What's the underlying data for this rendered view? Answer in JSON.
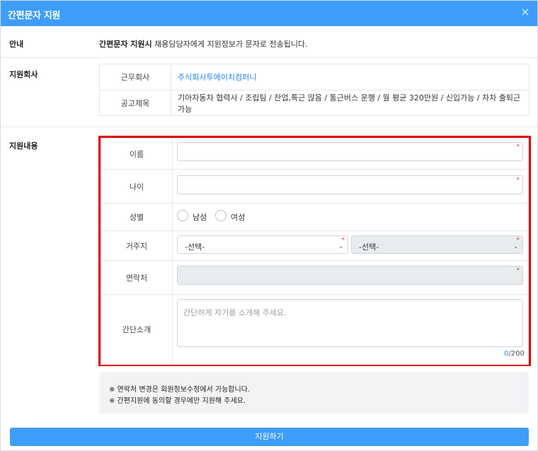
{
  "dialog": {
    "title": "간편문자 지원",
    "close_icon": "×"
  },
  "guide": {
    "label": "안내",
    "bold": "간편문자 지원시",
    "text": " 채용담당자에게 지원정보가 문자로 전송됩니다."
  },
  "company": {
    "label": "지원회사",
    "rows": [
      {
        "label": "근무회사",
        "value": "주식회사투에이치컴퍼니"
      },
      {
        "label": "공고제목",
        "value": "기아자동차 협력사 / 조립팀 / 잔업,특근 많음 / 통근버스 운행 / 월 평균 320만원 / 신입가능 / 자차 출퇴근 가능"
      }
    ]
  },
  "apply": {
    "label": "지원내용",
    "name_label": "이름",
    "age_label": "나이",
    "gender_label": "성별",
    "gender_options": [
      "남성",
      "여성"
    ],
    "residence_label": "거주지",
    "residence_select1": "-선택-",
    "residence_select2": "-선택-",
    "contact_label": "연락처",
    "intro_label": "간단소개",
    "intro_placeholder": "간단하게 자기를 소개해 주세요.",
    "counter_current": "0",
    "counter_max": "/200",
    "required_mark": "*"
  },
  "info": {
    "line1": "※ 연락처 변경은 회원정보수정에서 가능합니다.",
    "line2": "※ 간편지원에 동의할 경우에만 지원해 주세요."
  },
  "submit_label": "지원하기",
  "colors": {
    "accent": "#3d9df8",
    "link": "#2a86e6",
    "highlight_border": "#e00000",
    "required": "#e53935"
  }
}
